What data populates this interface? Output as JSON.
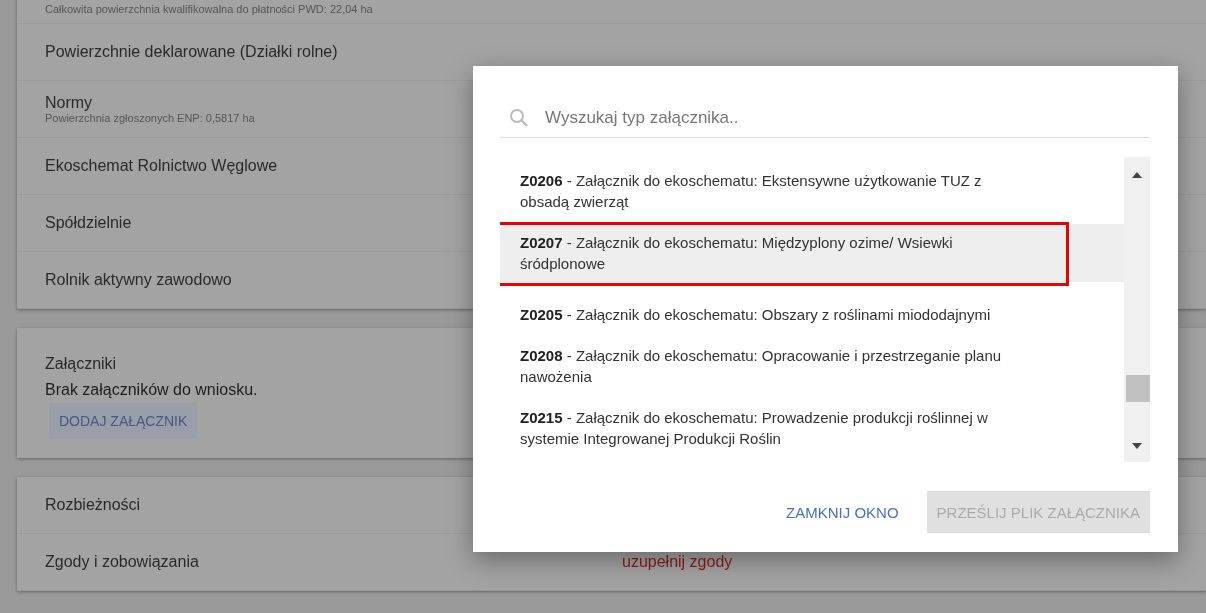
{
  "background": {
    "cards": [
      {
        "rows": [
          {
            "kind": "note",
            "title": "Całkowita powierzchnia kwalifikowalna do płatności PWD: 22,04 ha"
          },
          {
            "kind": "row",
            "title": "Powierzchnie deklarowane (Działki rolne)"
          },
          {
            "kind": "row",
            "title": "Normy",
            "subtitle": "Powierzchnia zgłoszonych ENP: 0,5817 ha"
          },
          {
            "kind": "row",
            "title": "Ekoschemat Rolnictwo Węglowe"
          },
          {
            "kind": "row",
            "title": "Spółdzielnie"
          },
          {
            "kind": "row",
            "title": "Rolnik aktywny zawodowo"
          }
        ]
      },
      {
        "rows": [
          {
            "kind": "attachments",
            "title": "Załączniki",
            "message": "Brak załączników do wniosku.",
            "button": "DODAJ ZAŁĄCZNIK"
          }
        ]
      },
      {
        "rows": [
          {
            "kind": "row",
            "title": "Rozbieżności"
          },
          {
            "kind": "row",
            "title": "Zgody i zobowiązania",
            "status": "uzupełnij zgody"
          }
        ]
      }
    ]
  },
  "dialog": {
    "search": {
      "placeholder": "Wyszukaj typ załącznika.."
    },
    "items": [
      {
        "text": "**Z0206** - Załącznik do ekoschematu: Ekstensywne użytkowanie TUZ z obsadą zwierząt",
        "selected": false
      },
      {
        "text": "**Z0207** - Załącznik do ekoschematu: Międzyplony ozime/ Wsiewki śródplonowe",
        "selected": true
      },
      {
        "text": "**Z0205** - Załącznik do ekoschematu: Obszary z roślinami miododajnymi",
        "selected": false
      },
      {
        "text": "**Z0208** - Załącznik do ekoschematu: Opracowanie i przestrzeganie planu nawożenia",
        "selected": false
      },
      {
        "text": "**Z0215** - Załącznik do ekoschematu: Prowadzenie produkcji roślinnej w systemie Integrowanej Produkcji Roślin",
        "selected": false
      }
    ],
    "buttons": [
      {
        "label": "ZAMKNIJ OKNO",
        "disabled": false
      },
      {
        "label": "PRZEŚLIJ PLIK ZAŁĄCZNIKA",
        "disabled": true
      }
    ]
  }
}
